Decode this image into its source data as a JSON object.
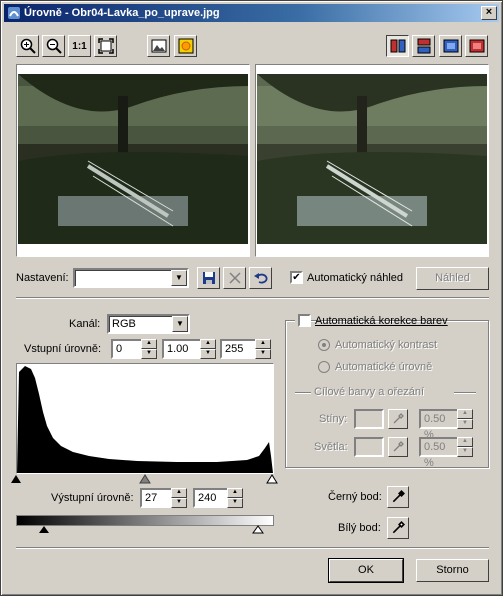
{
  "window": {
    "title": "Úrovně - Obr04-Lavka_po_uprave.jpg",
    "close_glyph": "×"
  },
  "toolbar": {
    "left": [
      {
        "name": "zoom-in-icon",
        "label": ""
      },
      {
        "name": "zoom-out-icon",
        "label": ""
      },
      {
        "name": "actual-size-icon",
        "label": "1:1"
      },
      {
        "name": "fit-window-icon",
        "label": ""
      },
      {
        "name": "image-icon",
        "label": ""
      },
      {
        "name": "sun-icon",
        "label": ""
      }
    ],
    "right": [
      "split-vertical-icon",
      "split-horizontal-icon",
      "preview-before-icon",
      "preview-after-icon"
    ]
  },
  "settings": {
    "label": "Nastavení:",
    "value": "",
    "auto_preview_label": "Automatický náhled",
    "auto_preview_checked": true,
    "preview_button": "Náhled"
  },
  "channel": {
    "label": "Kanál:",
    "value": "RGB"
  },
  "input_levels": {
    "label": "Vstupní úrovně:",
    "black": "0",
    "gamma": "1.00",
    "white": "255"
  },
  "output_levels": {
    "label": "Výstupní úrovně:",
    "black": "27",
    "white": "240"
  },
  "auto_color": {
    "checkbox_label": "Automatická korekce barev",
    "checked": false,
    "radio_contrast": "Automatický kontrast",
    "radio_levels": "Automatické úrovně",
    "target_header": "Cílové barvy a ořezání",
    "shadows_label": "Stíny:",
    "shadows_value": "0.50 %",
    "highlights_label": "Světla:",
    "highlights_value": "0.50 %"
  },
  "black_point": {
    "label": "Černý bod:"
  },
  "white_point": {
    "label": "Bílý bod:"
  },
  "buttons": {
    "ok": "OK",
    "cancel": "Storno"
  },
  "histogram": {
    "input_sliders": [
      0,
      1.0,
      255
    ],
    "output_sliders": [
      27,
      240
    ]
  },
  "colors": {
    "title_start": "#0a246a",
    "title_end": "#a6caf0",
    "face": "#d4d0c8"
  }
}
